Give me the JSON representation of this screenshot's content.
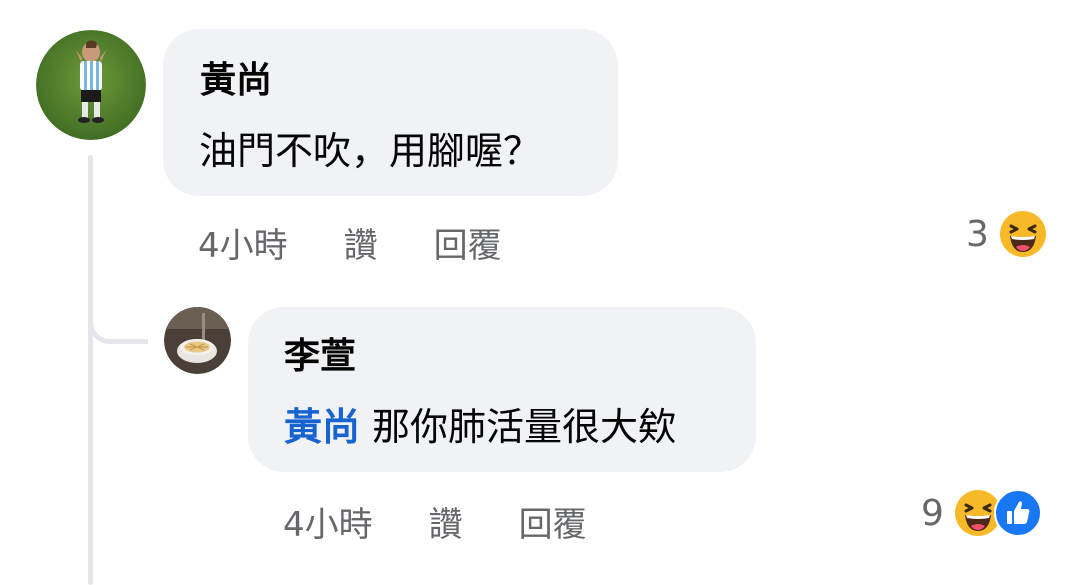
{
  "comments": [
    {
      "author": "黃尚",
      "text": "油門不吹，用腳喔？",
      "time": "4小時",
      "like_label": "讚",
      "reply_label": "回覆",
      "reaction_count": "3",
      "reactions": [
        "haha-icon"
      ]
    },
    {
      "author": "李萱",
      "mention": "黃尚",
      "text": "那你肺活量很大欸",
      "time": "4小時",
      "like_label": "讚",
      "reply_label": "回覆",
      "reaction_count": "9",
      "reactions": [
        "haha-icon",
        "like-icon"
      ]
    }
  ],
  "colors": {
    "bubble_bg": "#f0f2f5",
    "mention": "#1763cf",
    "meta_text": "#65676b",
    "like_blue": "#1877f2",
    "haha_yellow": "#f7b928"
  }
}
